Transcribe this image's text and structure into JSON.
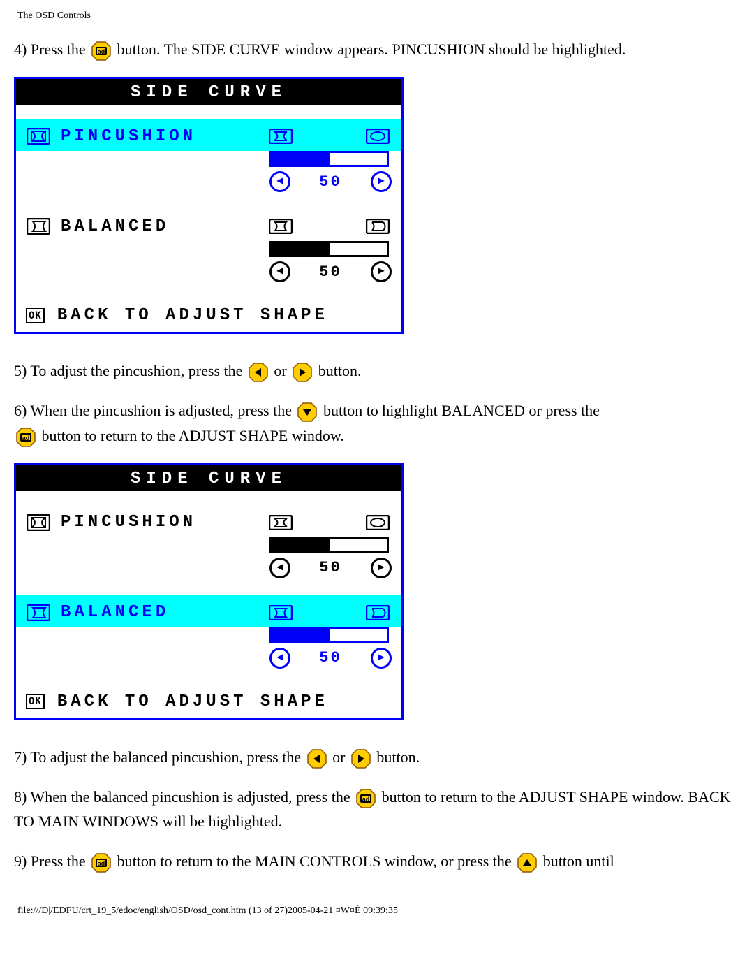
{
  "header": "The OSD Controls",
  "steps": {
    "s4_a": "4) Press the ",
    "s4_b": " button. The SIDE CURVE window appears. PINCUSHION should be highlighted.",
    "s5_a": "5) To adjust the pincushion, press the ",
    "s5_or": " or ",
    "s5_b": " button.",
    "s6_a": "6) When the pincushion is adjusted, press the ",
    "s6_b": " button to highlight BALANCED or press the ",
    "s6_c": " button to return to the ADJUST SHAPE window.",
    "s7_a": "7) To adjust the balanced pincushion, press the ",
    "s7_or": " or ",
    "s7_b": " button.",
    "s8_a": "8) When the balanced pincushion is adjusted, press the ",
    "s8_b": " button to return to the ADJUST SHAPE window. BACK TO MAIN WINDOWS will be highlighted.",
    "s9_a": "9) Press the ",
    "s9_b": " button to return to the MAIN CONTROLS window, or press the ",
    "s9_c": " button until"
  },
  "osd": {
    "title": "SIDE CURVE",
    "pincushion": {
      "label": "PINCUSHION",
      "value": "50",
      "fill_pct": 50
    },
    "balanced": {
      "label": "BALANCED",
      "value": "50",
      "fill_pct": 50
    },
    "back": {
      "ok": "OK",
      "label": "BACK TO ADJUST SHAPE"
    }
  },
  "footer": "file:///D|/EDFU/crt_19_5/edoc/english/OSD/osd_cont.htm (13 of 27)2005-04-21 ¤W¤È 09:39:35"
}
